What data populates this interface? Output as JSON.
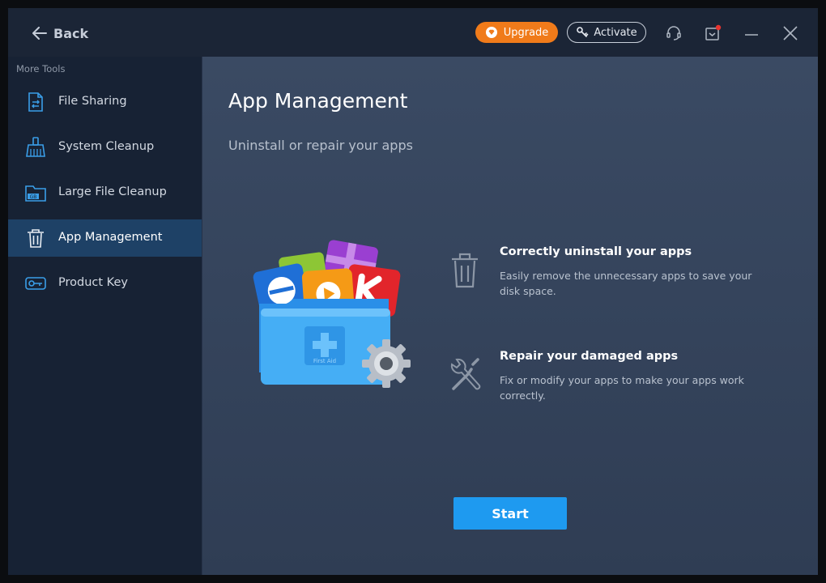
{
  "titlebar": {
    "back_label": "Back",
    "upgrade_label": "Upgrade",
    "activate_label": "Activate",
    "notification_dot_color": "#e8342f",
    "upgrade_color": "#f07b1a"
  },
  "sidebar": {
    "heading": "More Tools",
    "items": [
      {
        "label": "File Sharing",
        "icon": "file-sharing-icon",
        "active": false
      },
      {
        "label": "System Cleanup",
        "icon": "broom-icon",
        "active": false
      },
      {
        "label": "Large File Cleanup",
        "icon": "folder-gb-icon",
        "active": false
      },
      {
        "label": "App Management",
        "icon": "trash-icon",
        "active": true
      },
      {
        "label": "Product Key",
        "icon": "key-icon",
        "active": false
      }
    ]
  },
  "main": {
    "title": "App Management",
    "subtitle": "Uninstall or repair your apps",
    "illustration": {
      "badge_text": "First Aid"
    },
    "features": [
      {
        "title": "Correctly uninstall your apps",
        "description": "Easily remove the unnecessary apps to save your disk space.",
        "icon": "trash-icon"
      },
      {
        "title": "Repair your damaged apps",
        "description": "Fix or modify your apps to make your apps work correctly.",
        "icon": "wrench-screwdriver-icon"
      }
    ],
    "start_label": "Start",
    "accent_color": "#1e9af0"
  }
}
